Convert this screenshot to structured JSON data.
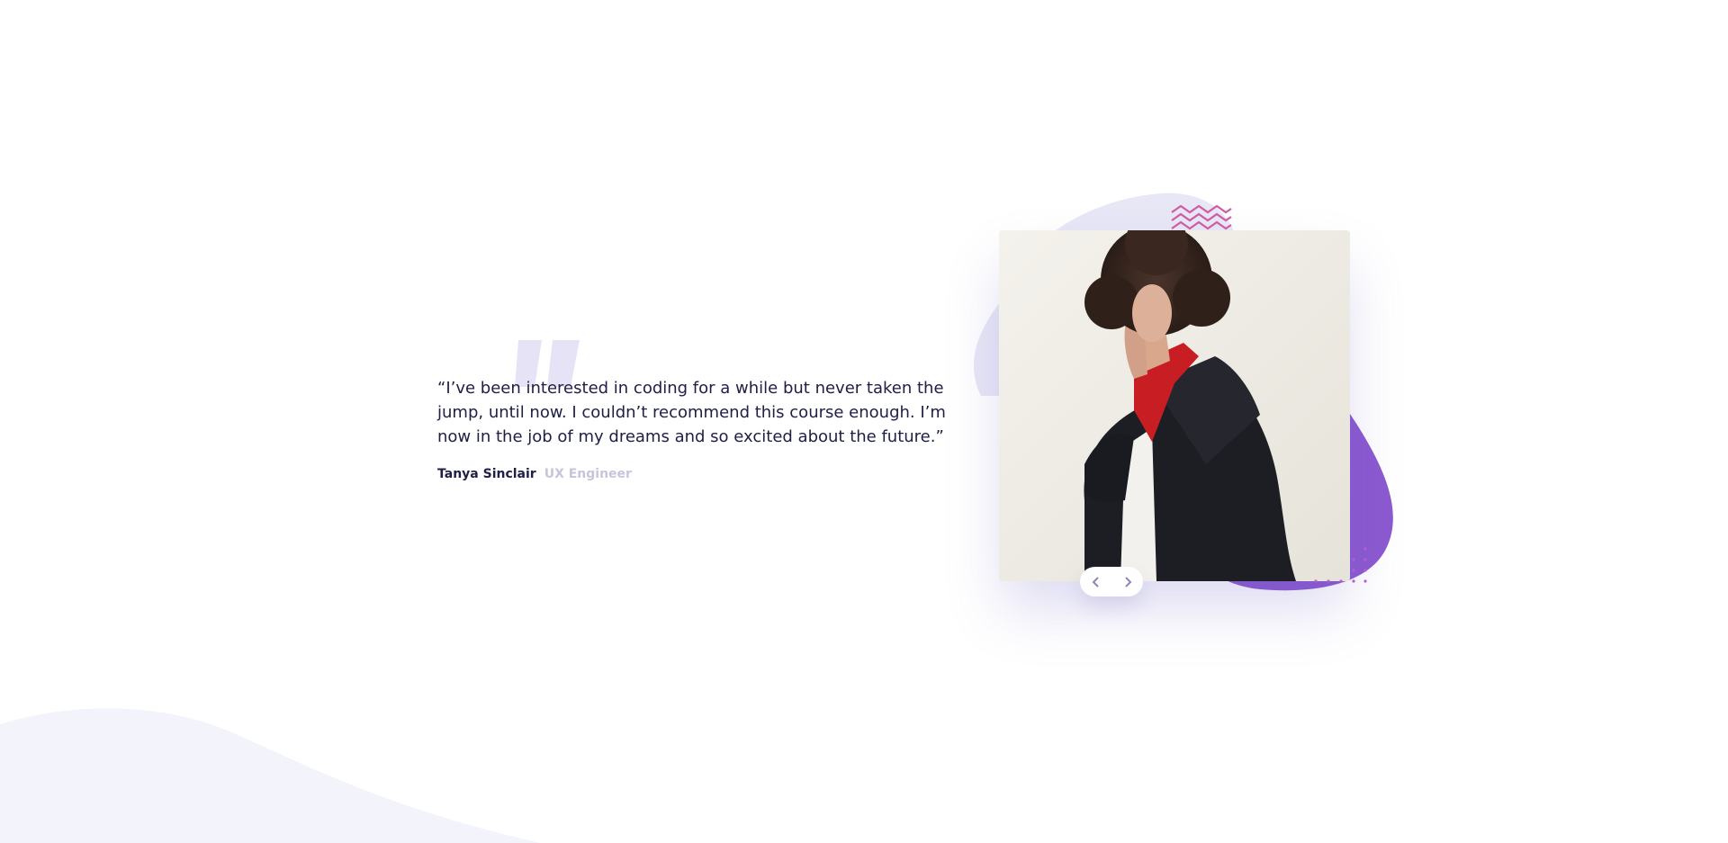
{
  "testimonial": {
    "quote": "“I’ve been interested in coding for a while but never taken the jump, until now. I couldn’t recommend this course enough. I’m now in the job of my dreams and so excited about the future.”",
    "author_name": "Tanya Sinclair",
    "author_role": "UX Engineer"
  },
  "icons": {
    "quote_mark": "quote-icon",
    "prev": "chevron-left-icon",
    "next": "chevron-right-icon",
    "zigzag": "zigzag-pattern-icon",
    "dots": "dot-grid-pattern-icon"
  },
  "colors": {
    "text_dark": "#202047",
    "text_muted": "#c7c5da",
    "accent_purple": "#8c59d0",
    "blob_light": "#e8e7f6",
    "pattern_pink": "#cf5ba2",
    "quote_mark": "#e6e3f6",
    "background_curve": "#f3f3fb"
  }
}
